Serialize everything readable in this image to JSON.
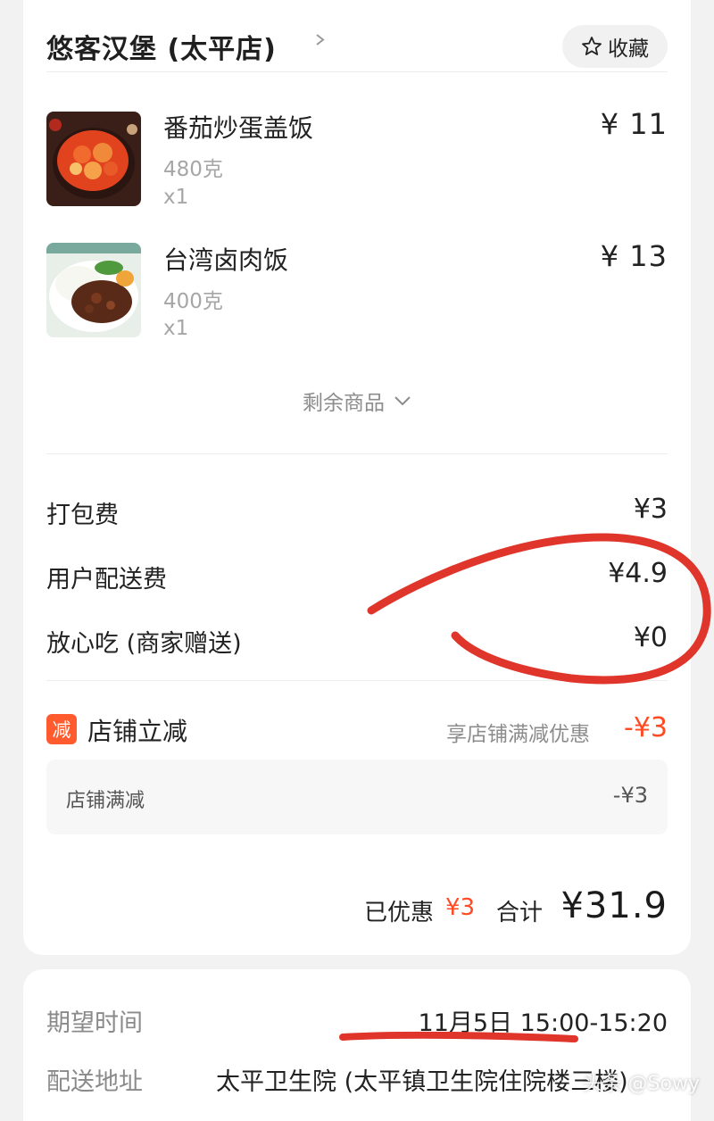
{
  "store": {
    "name": "悠客汉堡 (太平店)",
    "favorite_label": "收藏"
  },
  "items": [
    {
      "name": "番茄炒蛋盖饭",
      "weight": "480克",
      "qty": "x1",
      "price": "¥ 11"
    },
    {
      "name": "台湾卤肉饭",
      "weight": "400克",
      "qty": "x1",
      "price": "¥ 13"
    }
  ],
  "more_items_label": "剩余商品",
  "fees": [
    {
      "label": "打包费",
      "value": "¥3"
    },
    {
      "label": "用户配送费",
      "value": "¥4.9"
    },
    {
      "label": "放心吃 (商家赠送)",
      "value": "¥0"
    }
  ],
  "discount": {
    "badge": "减",
    "title": "店铺立减",
    "desc": "享店铺满减优惠",
    "amount": "-¥3",
    "sub_label": "店铺满减",
    "sub_value": "-¥3"
  },
  "summary": {
    "saved_label": "已优惠",
    "saved_amount": "¥3",
    "total_label": "合计",
    "total_amount": "¥31.9"
  },
  "delivery": {
    "time_label": "期望时间",
    "time_value": "11月5日 15:00-15:20",
    "address_label": "配送地址",
    "address_value": "太平卫生院 (太平镇卫生院住院楼三楼)"
  },
  "watermark": "头条 @Sowy",
  "colors": {
    "accent": "#ff4a24",
    "annotation": "#e0352a"
  }
}
